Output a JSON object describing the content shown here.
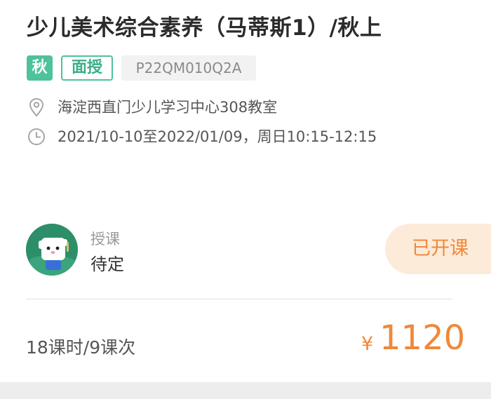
{
  "course": {
    "title": "少儿美术综合素养（马蒂斯1）/秋上",
    "tags": {
      "season": "秋",
      "mode": "面授",
      "code": "P22QM010Q2A"
    },
    "location": {
      "icon": "location-pin-icon",
      "text": "海淀西直门少儿学习中心308教室"
    },
    "schedule": {
      "icon": "clock-icon",
      "text": "2021/10-10至2022/01/09，周日10:15-12:15"
    }
  },
  "teacher": {
    "label": "授课",
    "name": "待定"
  },
  "status": {
    "label": "已开课"
  },
  "footer": {
    "lessons": "18课时/9课次",
    "currency": "¥",
    "price": "1120"
  },
  "colors": {
    "accent_green": "#4ec29b",
    "accent_orange": "#f0883a",
    "status_bg": "#fcebd9"
  }
}
